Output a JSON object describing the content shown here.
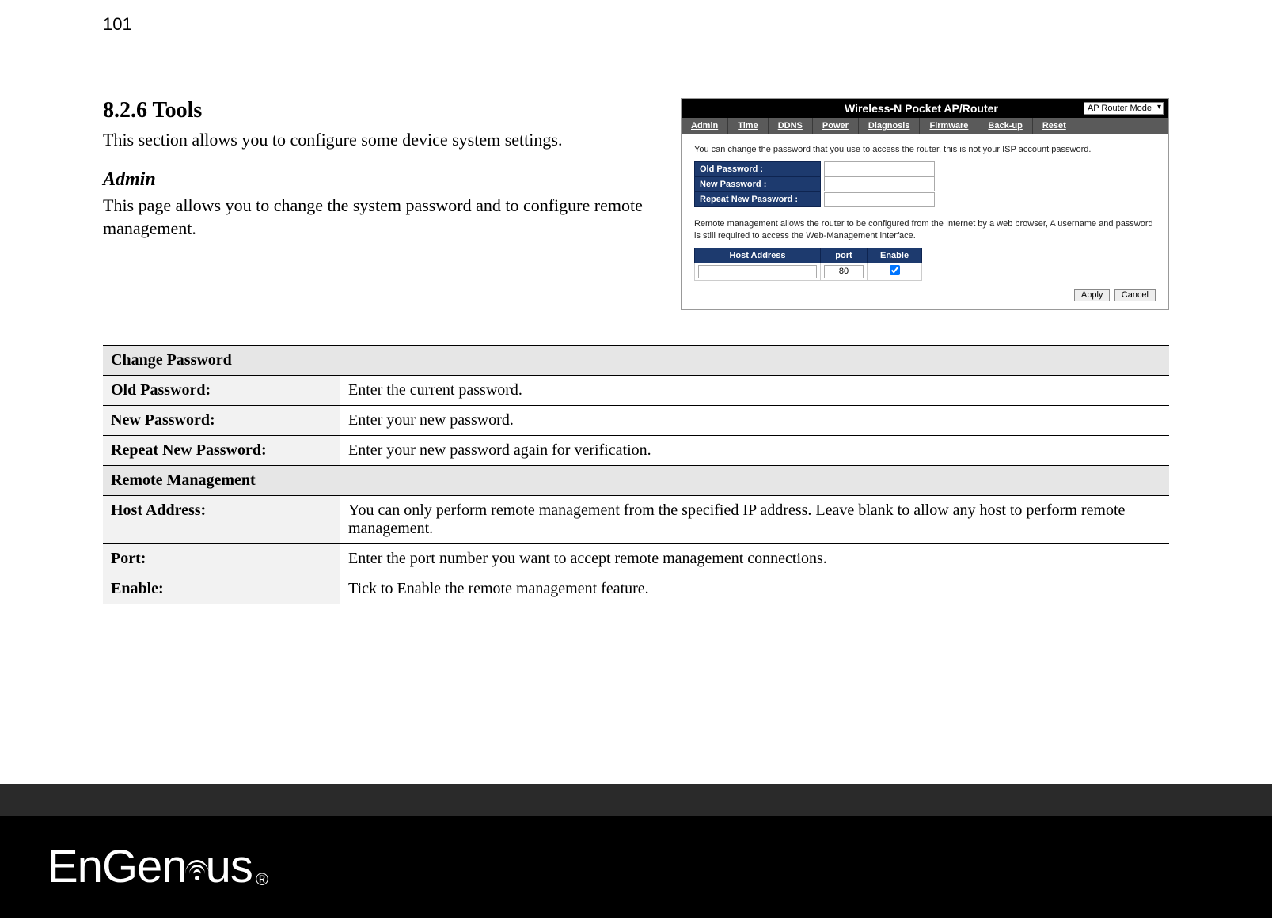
{
  "page_number": "101",
  "heading_section": "8.2.6 Tools",
  "intro_para": "This section allows you to configure some device system settings.",
  "subheading": "Admin",
  "admin_para": "This page allows you to change the system password and to configure remote management.",
  "screenshot": {
    "title": "Wireless-N Pocket AP/Router",
    "mode": "AP Router Mode",
    "tabs": [
      "Admin",
      "Time",
      "DDNS",
      "Power",
      "Diagnosis",
      "Firmware",
      "Back-up",
      "Reset"
    ],
    "note_pw_pre": "You can change the password that you use to access the router, this ",
    "note_pw_u": "is not",
    "note_pw_post": " your ISP account password.",
    "pw_rows": [
      {
        "label": "Old Password :"
      },
      {
        "label": "New Password :"
      },
      {
        "label": "Repeat New Password :"
      }
    ],
    "note_rm": "Remote management allows the router to be configured from the Internet by a web browser, A username and password is still required to access the Web-Management interface.",
    "rm_headers": [
      "Host Address",
      "port",
      "Enable"
    ],
    "rm_port_value": "80",
    "btn_apply": "Apply",
    "btn_cancel": "Cancel"
  },
  "def_table": {
    "section1": "Change Password",
    "rows1": [
      {
        "label": "Old Password:",
        "desc": "Enter the current password."
      },
      {
        "label": "New Password:",
        "desc": "Enter your new password."
      },
      {
        "label": "Repeat New Password:",
        "desc": "Enter your new password again for verification."
      }
    ],
    "section2": "Remote Management",
    "rows2": [
      {
        "label": "Host Address:",
        "desc": "You can only perform remote management from the specified IP address. Leave blank to allow any host to perform remote management."
      },
      {
        "label": "Port:",
        "desc": "Enter the port number you want to accept remote management connections."
      },
      {
        "label": "Enable:",
        "desc": "Tick to Enable the remote management feature."
      }
    ]
  },
  "logo_text": "EnGenius"
}
